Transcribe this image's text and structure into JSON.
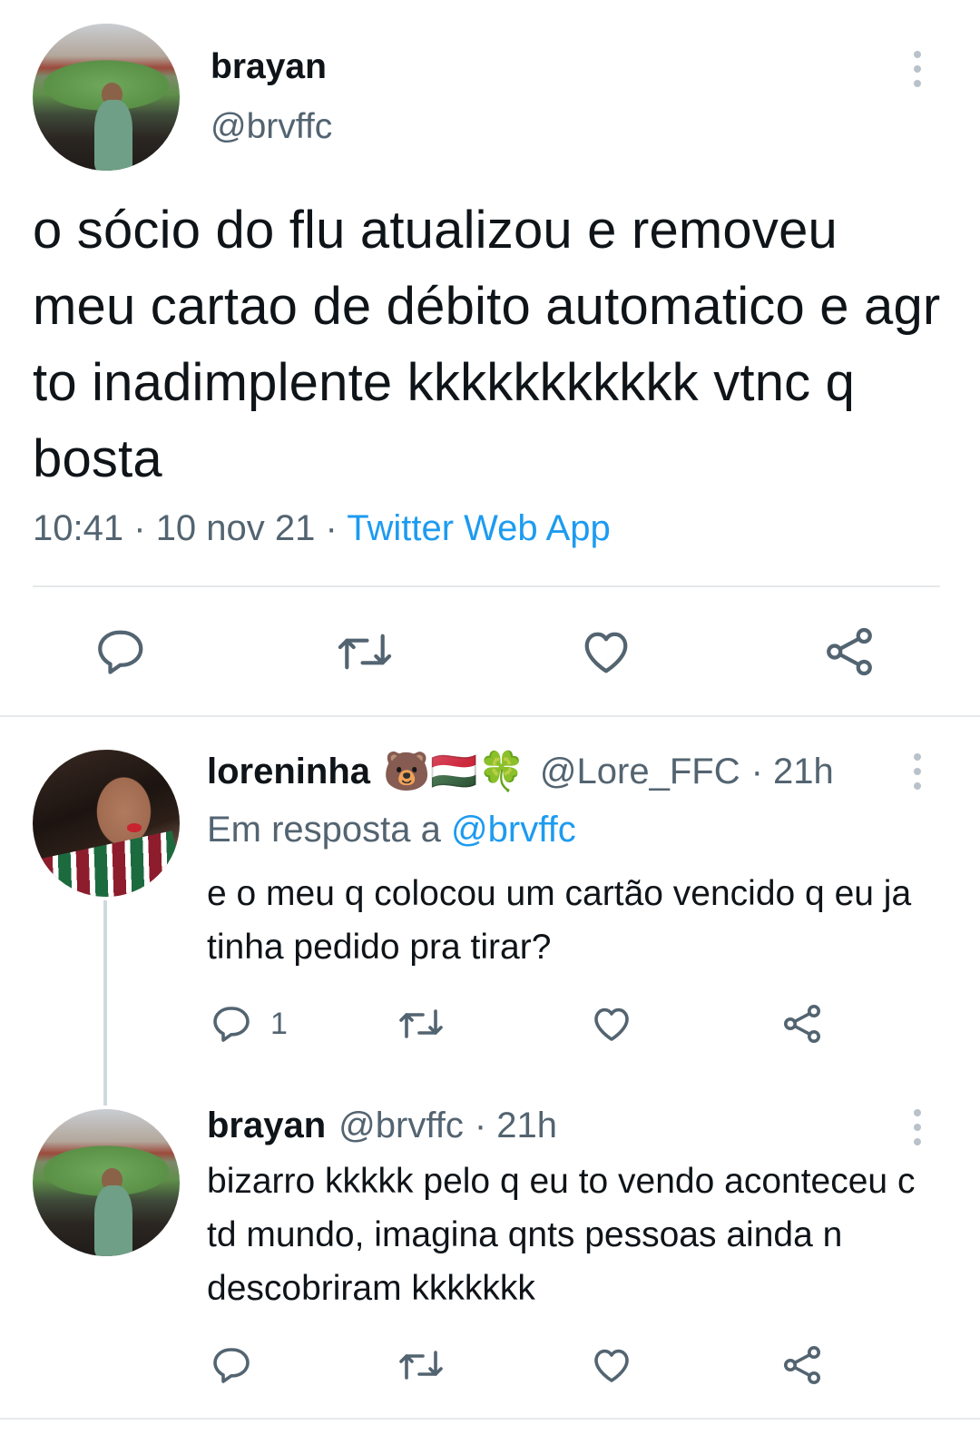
{
  "main_tweet": {
    "author_name": "brayan",
    "author_handle": "@brvffc",
    "text": "o sócio do flu atualizou e removeu meu cartao de débito automatico e agr to inadimplente kkkkkkkkkkk vtnc q bosta",
    "time": "10:41",
    "date": "10 nov 21",
    "separator": "·",
    "source": "Twitter Web App",
    "icons": [
      "reply-icon",
      "retweet-icon",
      "like-icon",
      "share-icon"
    ]
  },
  "reply1": {
    "author_name": "loreninha",
    "emojis": "🐻🇭🇺🍀",
    "author_handle": "@Lore_FFC",
    "age": "· 21h",
    "in_reply_prefix": "Em resposta a",
    "in_reply_mention": "@brvffc",
    "text": "e o meu q colocou um cartão vencido q eu ja tinha pedido pra tirar?",
    "reply_count": "1"
  },
  "reply2": {
    "author_name": "brayan",
    "author_handle": "@brvffc",
    "age": "· 21h",
    "text": "bizarro kkkkk pelo q eu to vendo aconteceu c td mundo, imagina qnts pessoas ainda n descobriram kkkkkkk"
  },
  "colors": {
    "text": "#0f1419",
    "secondary": "#536471",
    "accent": "#1d9bf0",
    "divider": "#e6e9eb"
  }
}
